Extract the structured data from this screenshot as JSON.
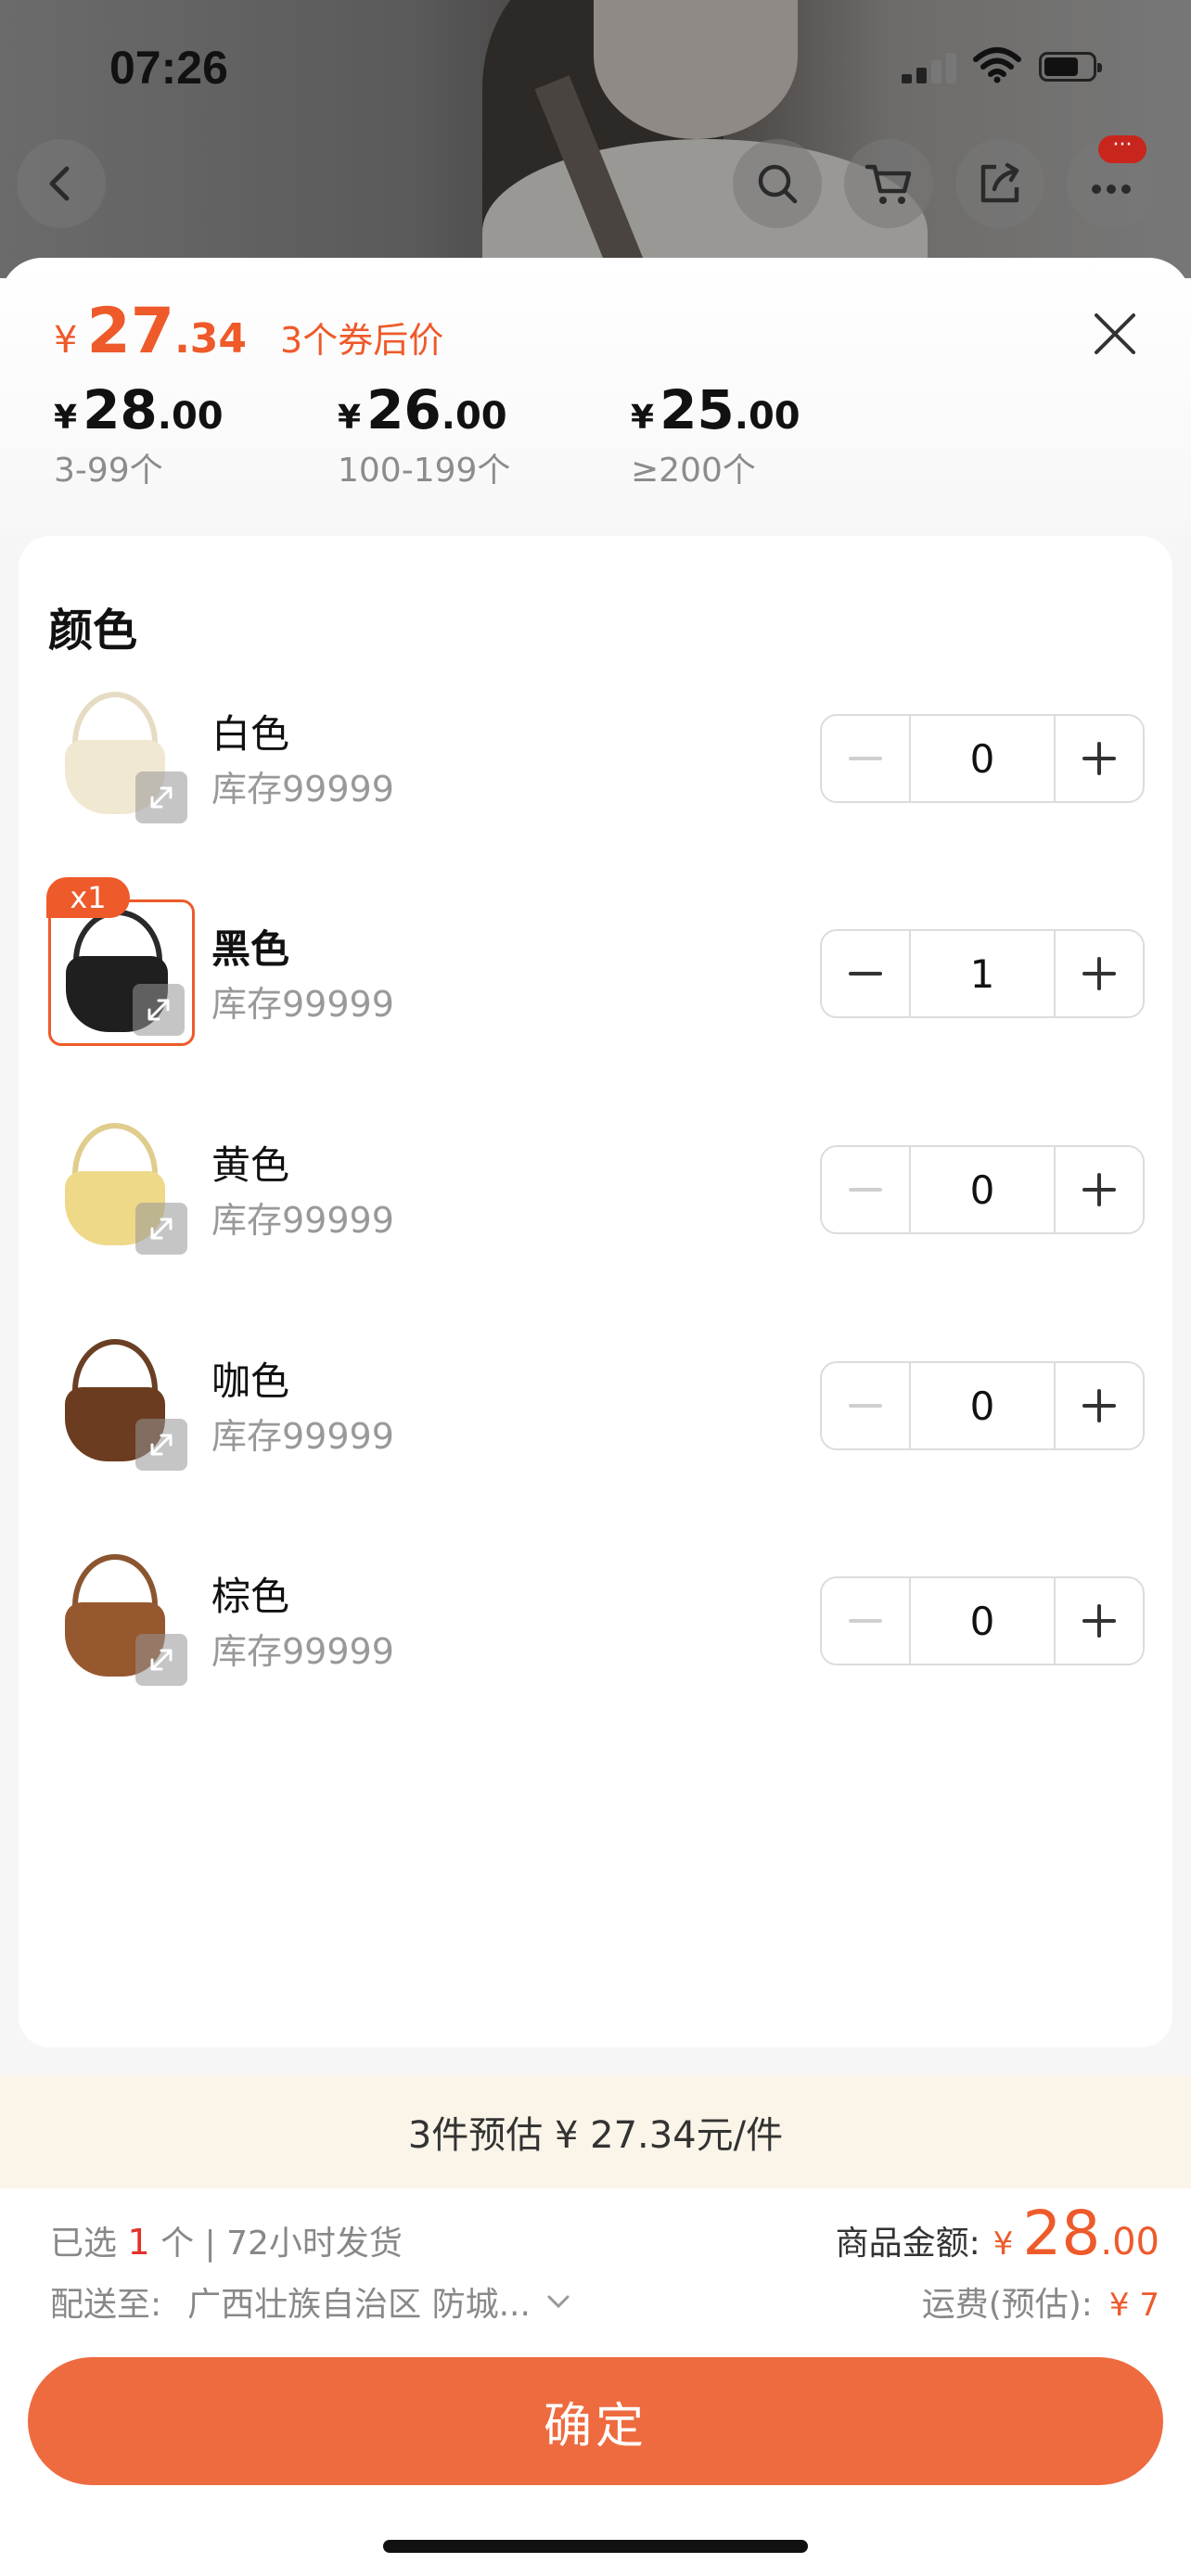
{
  "status_bar": {
    "time": "07:26"
  },
  "top_bar": {
    "back_icon": "chevron-left-icon",
    "search_icon": "search-icon",
    "cart_icon": "cart-icon",
    "share_icon": "share-icon",
    "more_icon": "more-icon",
    "badge": "···"
  },
  "sheet": {
    "price": {
      "yen": "¥",
      "int": "27",
      "dec": ".34",
      "note": "3个券后价"
    },
    "tiers": [
      {
        "yen": "¥",
        "int": "28",
        "dec": ".00",
        "range": "3-99个"
      },
      {
        "yen": "¥",
        "int": "26",
        "dec": ".00",
        "range": "100-199个"
      },
      {
        "yen": "¥",
        "int": "25",
        "dec": ".00",
        "range": "≥200个"
      }
    ],
    "section_title": "颜色",
    "options": [
      {
        "name": "白色",
        "stock": "库存99999",
        "qty": "0",
        "selected": false
      },
      {
        "name": "黑色",
        "stock": "库存99999",
        "qty": "1",
        "selected": true,
        "tag": "x1"
      },
      {
        "name": "黄色",
        "stock": "库存99999",
        "qty": "0",
        "selected": false
      },
      {
        "name": "咖色",
        "stock": "库存99999",
        "qty": "0",
        "selected": false
      },
      {
        "name": "棕色",
        "stock": "库存99999",
        "qty": "0",
        "selected": false
      }
    ]
  },
  "estimate": "3件预估 ¥ 27.34元/件",
  "footer": {
    "selected_prefix": "已选",
    "selected_count": "1",
    "selected_suffix": "个 | 72小时发货",
    "ship_label": "配送至:",
    "ship_address": "广西壮族自治区 防城...",
    "total_label": "商品金额:",
    "total_yen": "¥",
    "total_int": "28",
    "total_dec": ".00",
    "freight_label": "运费(预估):",
    "freight_value": "¥ 7",
    "confirm_label": "确定"
  },
  "colors": {
    "accent": "#ee5a2a",
    "button": "#ee6b3f",
    "estimate_bg": "#fbf5e9"
  }
}
